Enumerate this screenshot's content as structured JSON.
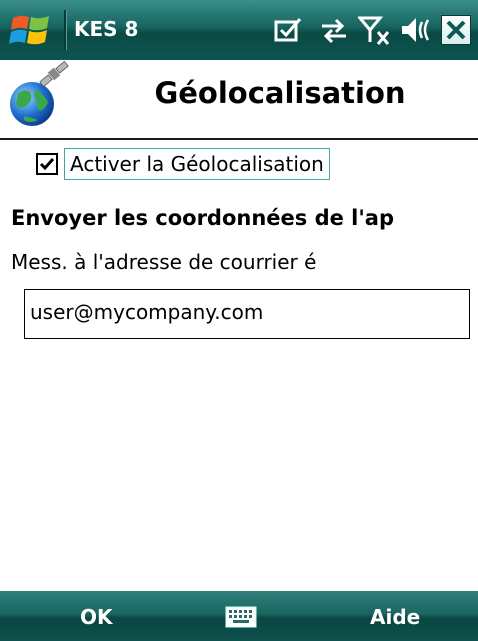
{
  "statusbar": {
    "app_title": "KES 8",
    "icons": [
      "windows-start-icon",
      "checkbox-notification-icon",
      "sync-arrows-icon",
      "no-signal-icon",
      "volume-off-icon",
      "close-icon"
    ]
  },
  "header": {
    "title": "Géolocalisation",
    "icon": "satellite-globe-icon"
  },
  "content": {
    "checkbox_label": "Activer la Géolocalisation",
    "checkbox_checked": true,
    "section_heading": "Envoyer les coordonnées de l'ap",
    "email_label": "Mess. à l'adresse de courrier é",
    "email_value": "user@mycompany.com"
  },
  "softkeys": {
    "left": "OK",
    "right": "Aide",
    "center_icon": "keyboard-icon"
  },
  "colors": {
    "bar_teal": "#16645f",
    "focus_border": "#3fa6a4"
  }
}
